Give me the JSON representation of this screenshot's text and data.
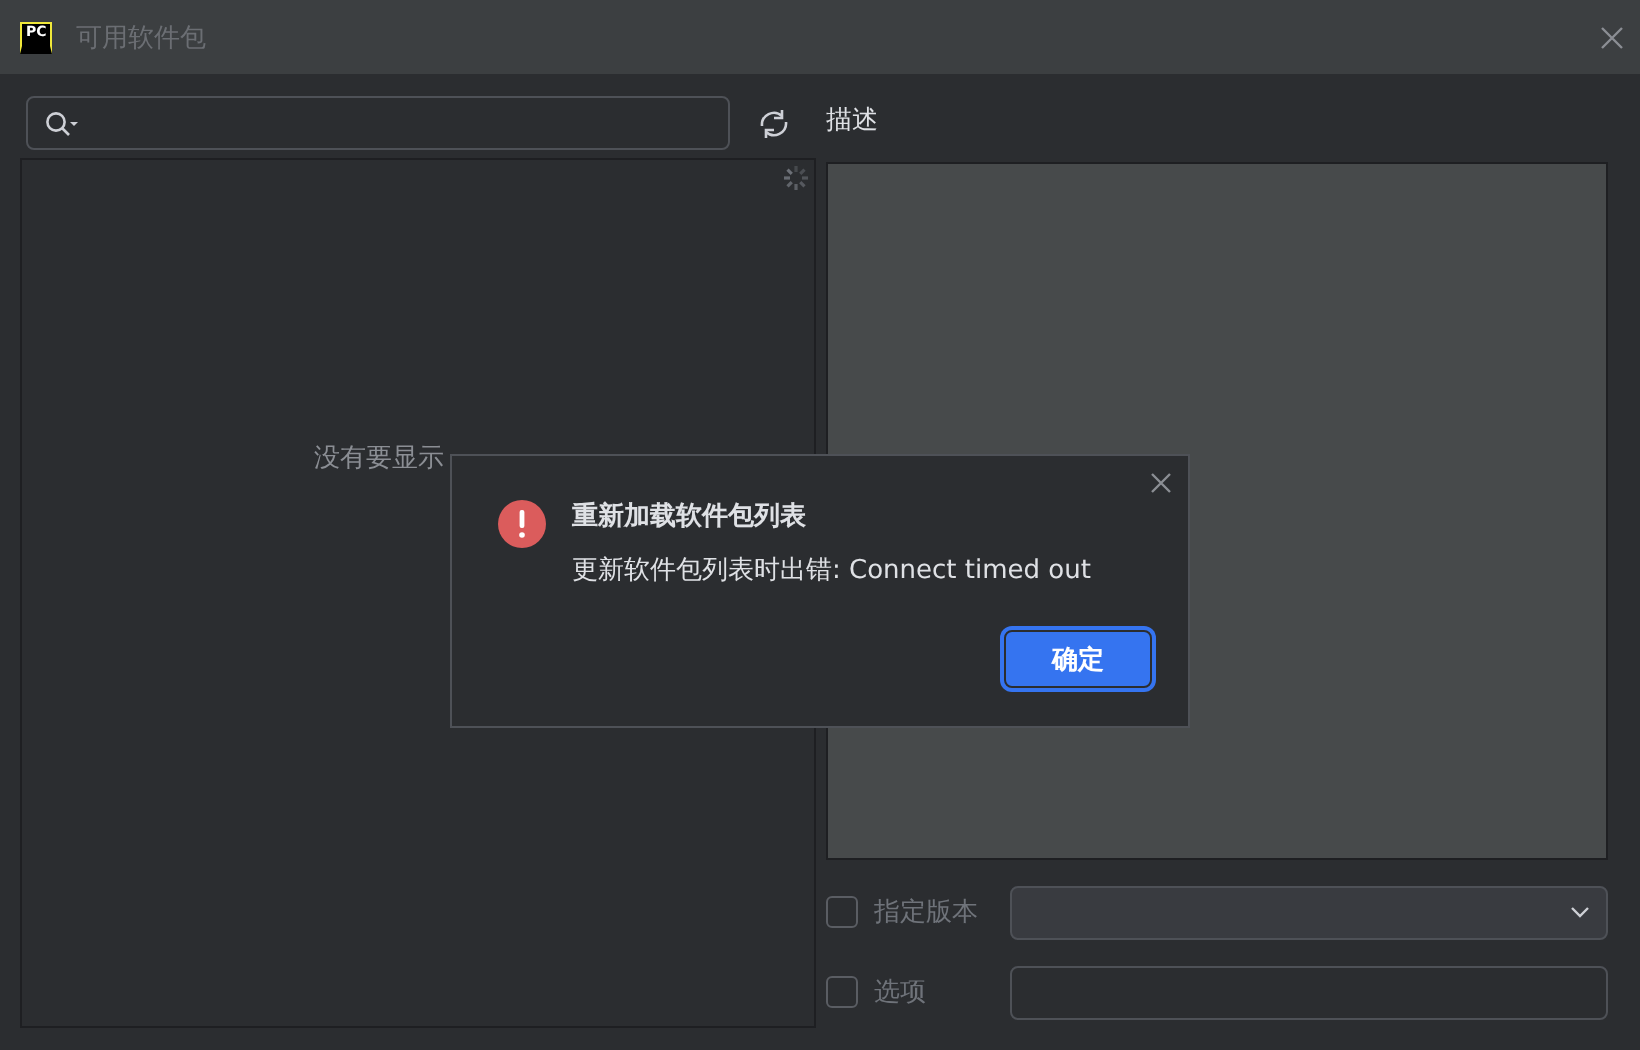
{
  "window": {
    "logo": "PC",
    "title": "可用软件包"
  },
  "package_list": {
    "empty_text": "没有要显示"
  },
  "description": {
    "label": "描述"
  },
  "options": [
    {
      "kind": "dropdown",
      "label": "指定版本",
      "checked": false
    },
    {
      "kind": "text",
      "label": "选项",
      "checked": false
    }
  ],
  "dialog": {
    "title": "重新加载软件包列表",
    "message": "更新软件包列表时出错: Connect timed out",
    "button": "确定"
  }
}
